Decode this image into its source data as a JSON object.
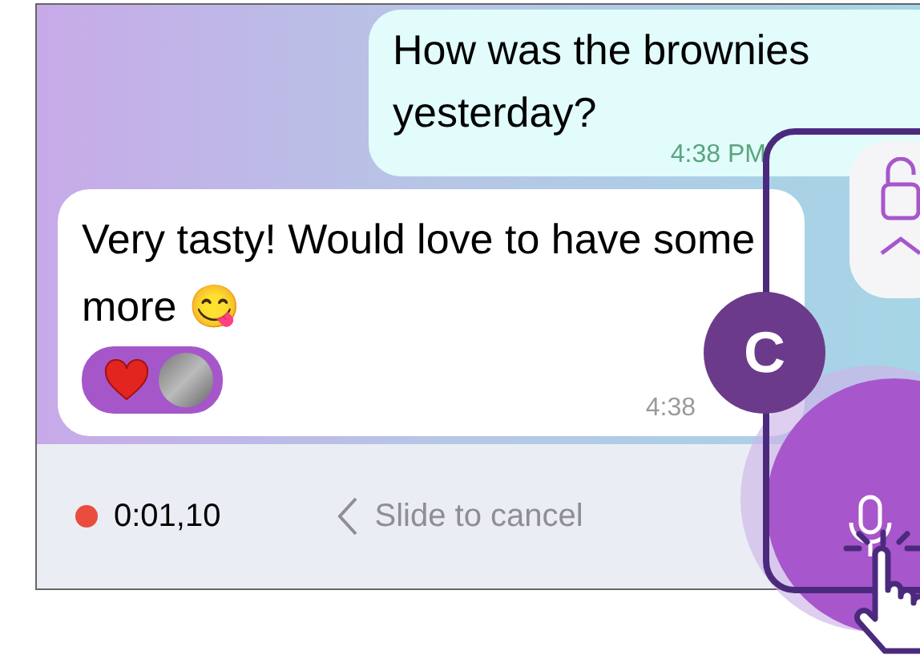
{
  "messages": [
    {
      "kind": "outgoing",
      "text": "How was the brownies yesterday?",
      "time": "4:38 PM"
    },
    {
      "kind": "incoming",
      "text": "Very tasty! Would love to have some more 😋",
      "time": "4:38",
      "reactions": [
        {
          "kind": "heart"
        },
        {
          "kind": "avatar"
        }
      ]
    }
  ],
  "recording": {
    "duration": "0:01,10",
    "hint": "Slide to cancel"
  },
  "callout": {
    "label": "C"
  }
}
